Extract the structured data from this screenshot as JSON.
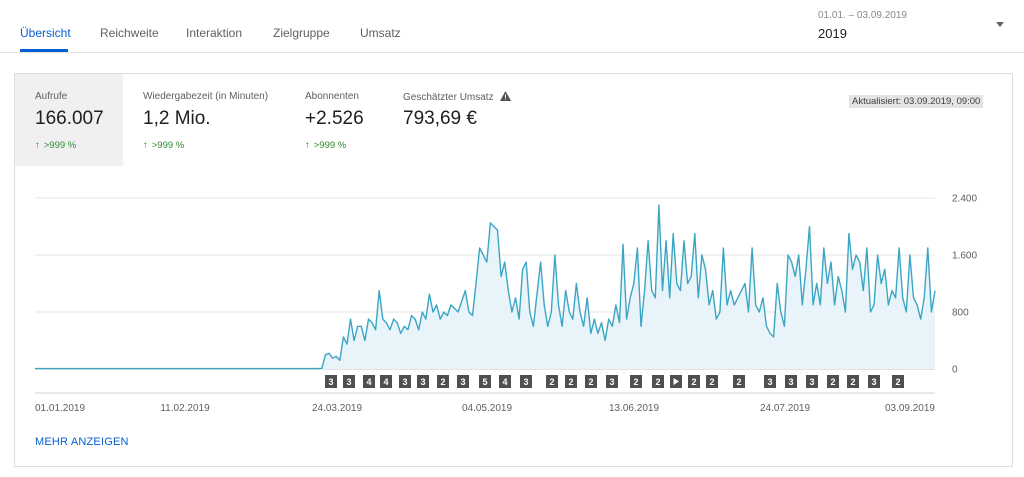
{
  "tabs": [
    {
      "label": "Übersicht",
      "active": true
    },
    {
      "label": "Reichweite",
      "active": false
    },
    {
      "label": "Interaktion",
      "active": false
    },
    {
      "label": "Zielgruppe",
      "active": false
    },
    {
      "label": "Umsatz",
      "active": false
    }
  ],
  "date_filter": {
    "range": "01.01. – 03.09.2019",
    "selected": "2019"
  },
  "metrics": [
    {
      "label": "Aufrufe",
      "value": "166.007",
      "delta": ">999 %"
    },
    {
      "label": "Wiedergabezeit (in Minuten)",
      "value": "1,2 Mio.",
      "delta": ">999 %"
    },
    {
      "label": "Abonnenten",
      "value": "+2.526",
      "delta": ">999 %"
    },
    {
      "label": "Geschätzter Umsatz",
      "value": "793,69 €",
      "icon": "warning-icon"
    }
  ],
  "updated_label": "Aktualisiert: 03.09.2019, 09:00",
  "more_label": "MEHR ANZEIGEN",
  "colors": {
    "accent": "#065fd4",
    "line": "#3ba6c4",
    "area": "#e8f4f9",
    "positive": "#2e8b2e"
  },
  "chart_data": {
    "type": "area",
    "title": "",
    "xlabel": "",
    "ylabel": "",
    "ylim": [
      0,
      2400
    ],
    "yticks": [
      "0",
      "800",
      "1.600",
      "2.400"
    ],
    "xticks": [
      "01.01.2019",
      "11.02.2019",
      "24.03.2019",
      "04.05.2019",
      "13.06.2019",
      "24.07.2019",
      "03.09.2019"
    ],
    "grid": true,
    "series": [
      {
        "x_start": "01.01.2019",
        "x_end": "03.09.2019",
        "values": [
          5,
          5,
          5,
          5,
          5,
          5,
          5,
          5,
          5,
          5,
          5,
          5,
          5,
          5,
          5,
          5,
          5,
          5,
          5,
          5,
          5,
          5,
          5,
          5,
          5,
          5,
          5,
          5,
          5,
          5,
          5,
          5,
          5,
          5,
          5,
          5,
          5,
          5,
          5,
          5,
          5,
          5,
          5,
          5,
          5,
          5,
          5,
          5,
          5,
          5,
          5,
          5,
          5,
          5,
          5,
          5,
          5,
          5,
          5,
          5,
          5,
          5,
          5,
          5,
          5,
          5,
          5,
          5,
          5,
          5,
          5,
          5,
          5,
          5,
          5,
          5,
          5,
          5,
          5,
          5,
          10,
          200,
          220,
          150,
          180,
          120,
          450,
          350,
          700,
          400,
          600,
          600,
          400,
          700,
          650,
          550,
          1100,
          700,
          650,
          550,
          700,
          650,
          500,
          600,
          550,
          750,
          700,
          550,
          800,
          700,
          1050,
          800,
          900,
          700,
          800,
          750,
          900,
          850,
          800,
          950,
          1100,
          800,
          750,
          1200,
          1700,
          1600,
          1500,
          2050,
          2000,
          1950,
          1300,
          1500,
          1100,
          800,
          1000,
          700,
          1400,
          1500,
          800,
          600,
          1050,
          1500,
          900,
          600,
          800,
          1600,
          900,
          600,
          1100,
          800,
          700,
          1200,
          800,
          600,
          1000,
          500,
          700,
          500,
          650,
          400,
          700,
          600,
          900,
          650,
          1750,
          700,
          1000,
          1200,
          1700,
          600,
          1100,
          1800,
          1100,
          1000,
          2300,
          1100,
          1800,
          1000,
          1900,
          1200,
          1100,
          1800,
          1200,
          1300,
          1900,
          1000,
          1600,
          1400,
          900,
          1100,
          700,
          800,
          1700,
          900,
          1100,
          900,
          1000,
          1100,
          1200,
          800,
          1700,
          900,
          800,
          1000,
          600,
          500,
          450,
          1200,
          800,
          600,
          1600,
          1500,
          1300,
          1600,
          900,
          1400,
          2000,
          900,
          1200,
          900,
          1700,
          1200,
          1500,
          900,
          1300,
          1100,
          800,
          1900,
          1400,
          1600,
          1500,
          1100,
          1700,
          800,
          900,
          1600,
          1200,
          1400,
          900,
          1100,
          1000,
          1700,
          1000,
          800,
          1600,
          1000,
          900,
          700,
          1000,
          1700,
          800,
          1100
        ]
      }
    ],
    "annotations": [
      "3",
      "3",
      "4",
      "4",
      "3",
      "3",
      "2",
      "3",
      "5",
      "4",
      "3",
      "2",
      "2",
      "2",
      "3",
      "2",
      "2",
      "play",
      "2",
      "2",
      "2",
      "3",
      "3",
      "3",
      "2",
      "2",
      "3",
      "2"
    ]
  }
}
